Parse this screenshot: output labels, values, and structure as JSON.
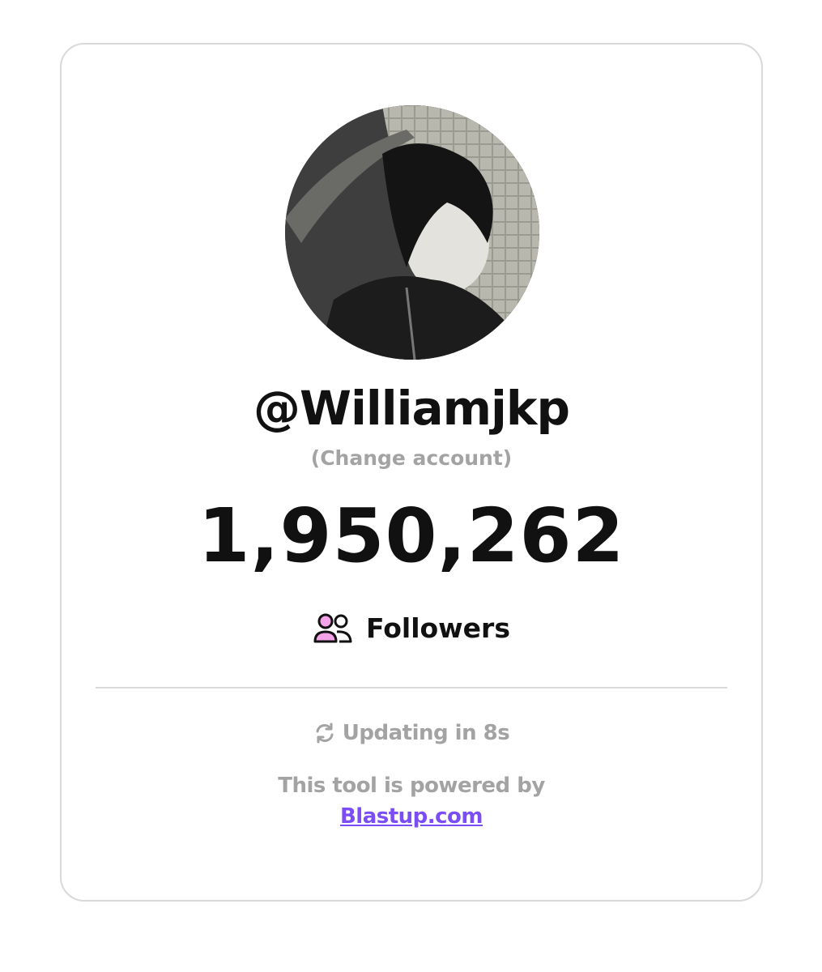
{
  "profile": {
    "username": "@Williamjkp",
    "change_account": "(Change account)",
    "follower_count": "1,950,262",
    "followers_label": "Followers"
  },
  "status": {
    "updating_text": "Updating in 8s"
  },
  "footer": {
    "powered_text": "This tool is powered by",
    "link_text": "Blastup.com"
  },
  "icons": {
    "followers": "users-icon",
    "refresh": "refresh-icon"
  },
  "colors": {
    "text": "#111111",
    "muted": "#a3a3a3",
    "link": "#7b4df5",
    "icon_accent": "#f5a3e8",
    "border": "#d9d9d9"
  }
}
